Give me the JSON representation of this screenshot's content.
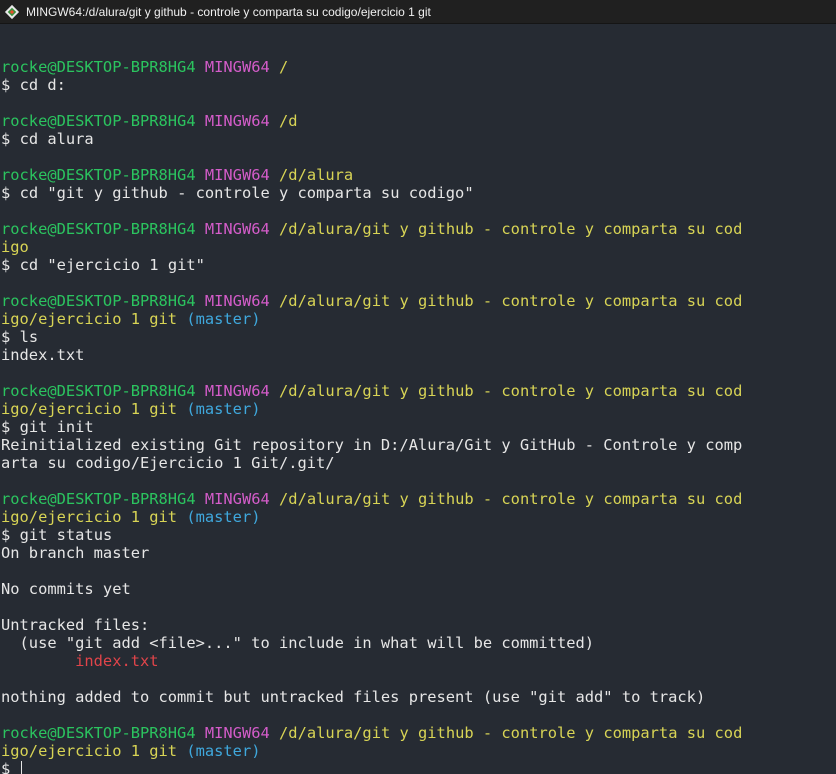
{
  "window": {
    "title": "MINGW64:/d/alura/git y github - controle y comparta su codigo/ejercicio 1 git"
  },
  "prompt": {
    "user_host": "rocke@DESKTOP-BPR8HG4",
    "shell": "MINGW64",
    "symbol": "$"
  },
  "session": [
    {
      "type": "blank"
    },
    {
      "type": "prompt",
      "path": "/"
    },
    {
      "type": "cmd",
      "text": "cd d:"
    },
    {
      "type": "blank"
    },
    {
      "type": "prompt",
      "path": "/d"
    },
    {
      "type": "cmd",
      "text": "cd alura"
    },
    {
      "type": "blank"
    },
    {
      "type": "prompt",
      "path": "/d/alura"
    },
    {
      "type": "cmd",
      "text": "cd \"git y github - controle y comparta su codigo\""
    },
    {
      "type": "blank"
    },
    {
      "type": "prompt",
      "path": "/d/alura/git y github - controle y comparta su cod"
    },
    {
      "type": "cont",
      "path": "igo"
    },
    {
      "type": "cmd",
      "text": "cd \"ejercicio 1 git\""
    },
    {
      "type": "blank"
    },
    {
      "type": "prompt",
      "path": "/d/alura/git y github - controle y comparta su cod"
    },
    {
      "type": "cont",
      "path": "igo/ejercicio 1 git",
      "branch": "(master)"
    },
    {
      "type": "cmd",
      "text": "ls"
    },
    {
      "type": "out",
      "text": "index.txt"
    },
    {
      "type": "blank"
    },
    {
      "type": "prompt",
      "path": "/d/alura/git y github - controle y comparta su cod"
    },
    {
      "type": "cont",
      "path": "igo/ejercicio 1 git",
      "branch": "(master)"
    },
    {
      "type": "cmd",
      "text": "git init"
    },
    {
      "type": "out",
      "text": "Reinitialized existing Git repository in D:/Alura/Git y GitHub - Controle y comp"
    },
    {
      "type": "out",
      "text": "arta su codigo/Ejercicio 1 Git/.git/"
    },
    {
      "type": "blank"
    },
    {
      "type": "prompt",
      "path": "/d/alura/git y github - controle y comparta su cod"
    },
    {
      "type": "cont",
      "path": "igo/ejercicio 1 git",
      "branch": "(master)"
    },
    {
      "type": "cmd",
      "text": "git status"
    },
    {
      "type": "out",
      "text": "On branch master"
    },
    {
      "type": "blank"
    },
    {
      "type": "out",
      "text": "No commits yet"
    },
    {
      "type": "blank"
    },
    {
      "type": "out",
      "text": "Untracked files:"
    },
    {
      "type": "out",
      "text": "  (use \"git add <file>...\" to include in what will be committed)"
    },
    {
      "type": "red",
      "text": "        index.txt"
    },
    {
      "type": "blank"
    },
    {
      "type": "out",
      "text": "nothing added to commit but untracked files present (use \"git add\" to track)"
    },
    {
      "type": "blank"
    },
    {
      "type": "prompt",
      "path": "/d/alura/git y github - controle y comparta su cod"
    },
    {
      "type": "cont",
      "path": "igo/ejercicio 1 git",
      "branch": "(master)"
    },
    {
      "type": "input",
      "text": ""
    }
  ]
}
